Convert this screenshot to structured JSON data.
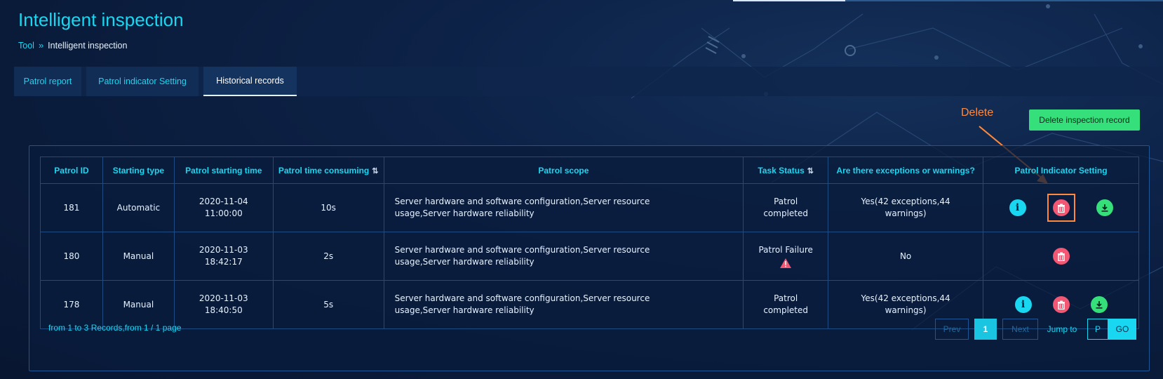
{
  "header": {
    "title": "Intelligent inspection",
    "breadcrumb": {
      "root": "Tool",
      "separator": "»",
      "current": "Intelligent inspection"
    }
  },
  "tabs": [
    {
      "label": "Patrol report",
      "active": false
    },
    {
      "label": "Patrol indicator Setting",
      "active": false
    },
    {
      "label": "Historical records",
      "active": true
    }
  ],
  "annotation": {
    "label": "Delete",
    "color": "#ff8a3d"
  },
  "toolbar": {
    "delete_record_label": "Delete inspection record"
  },
  "table": {
    "columns": [
      "Patrol ID",
      "Starting type",
      "Patrol starting time",
      "Patrol time consuming",
      "Patrol scope",
      "Task Status",
      "Are there exceptions or warnings?",
      "Patrol Indicator Setting"
    ],
    "rows": [
      {
        "id": "181",
        "type": "Automatic",
        "date": "2020-11-04",
        "time": "11:00:00",
        "duration": "10s",
        "scope": "Server hardware and software configuration,Server resource usage,Server hardware reliability",
        "status": "Patrol completed",
        "status_warning": false,
        "exceptions": "Yes(42 exceptions,44 warnings)",
        "actions": [
          "info-icon",
          "delete-icon",
          "download-icon"
        ]
      },
      {
        "id": "180",
        "type": "Manual",
        "date": "2020-11-03",
        "time": "18:42:17",
        "duration": "2s",
        "scope": "Server hardware and software configuration,Server resource usage,Server hardware reliability",
        "status": "Patrol Failure",
        "status_warning": true,
        "exceptions": "No",
        "actions": [
          "delete-icon"
        ]
      },
      {
        "id": "178",
        "type": "Manual",
        "date": "2020-11-03",
        "time": "18:40:50",
        "duration": "5s",
        "scope": "Server hardware and software configuration,Server resource usage,Server hardware reliability",
        "status": "Patrol completed",
        "status_warning": false,
        "exceptions": "Yes(42 exceptions,44 warnings)",
        "actions": [
          "info-icon",
          "delete-icon",
          "download-icon"
        ]
      }
    ]
  },
  "pagination": {
    "info": "from 1 to 3 Records,from 1 / 1 page",
    "prev": "Prev",
    "current_page": "1",
    "next": "Next",
    "jump_label": "Jump to",
    "input_placeholder": "P",
    "go": "GO"
  },
  "colors": {
    "accent": "#19d7f0",
    "danger": "#f25773",
    "success": "#35e07a",
    "highlight": "#ff8a3d"
  }
}
